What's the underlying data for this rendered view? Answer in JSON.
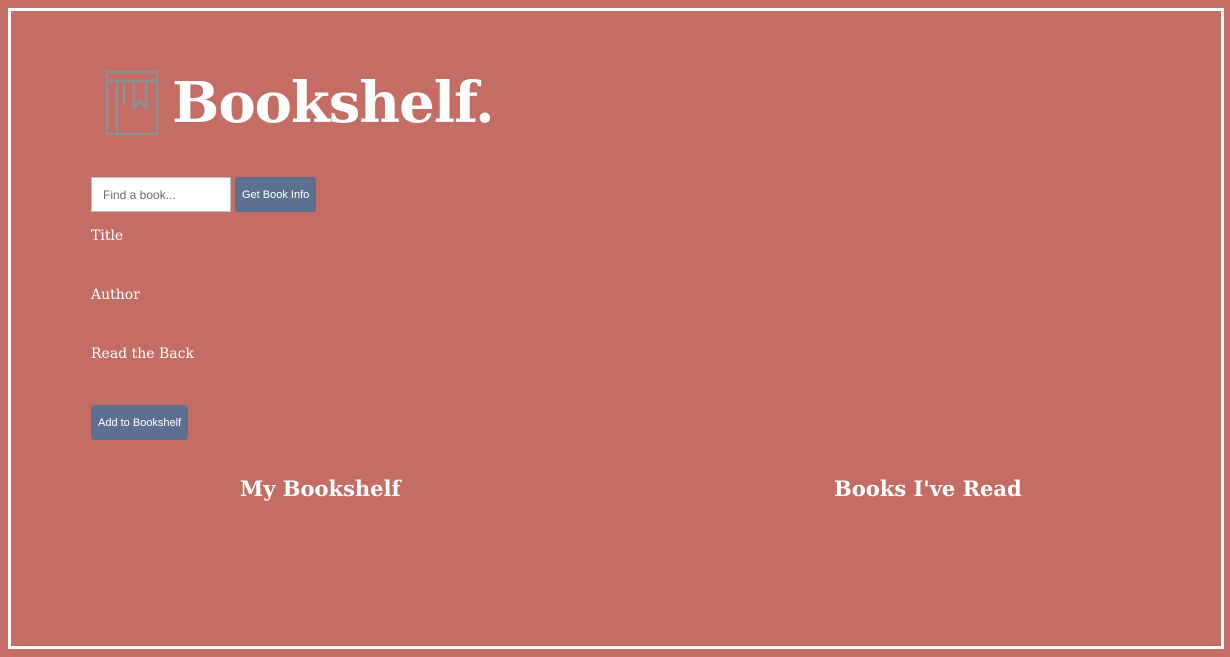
{
  "app": {
    "title": "Bookshelf.",
    "logo_icon": "book-icon"
  },
  "colors": {
    "background": "#c46d64",
    "button": "#5e7090",
    "text": "#ffffff",
    "icon": "#8f8f8f"
  },
  "search": {
    "placeholder": "Find a book...",
    "value": "",
    "button_label": "Get Book Info"
  },
  "book_info": {
    "title_label": "Title",
    "author_label": "Author",
    "back_label": "Read the Back"
  },
  "actions": {
    "add_label": "Add to Bookshelf"
  },
  "lists": {
    "my_bookshelf": "My Bookshelf",
    "books_read": "Books I've Read"
  }
}
